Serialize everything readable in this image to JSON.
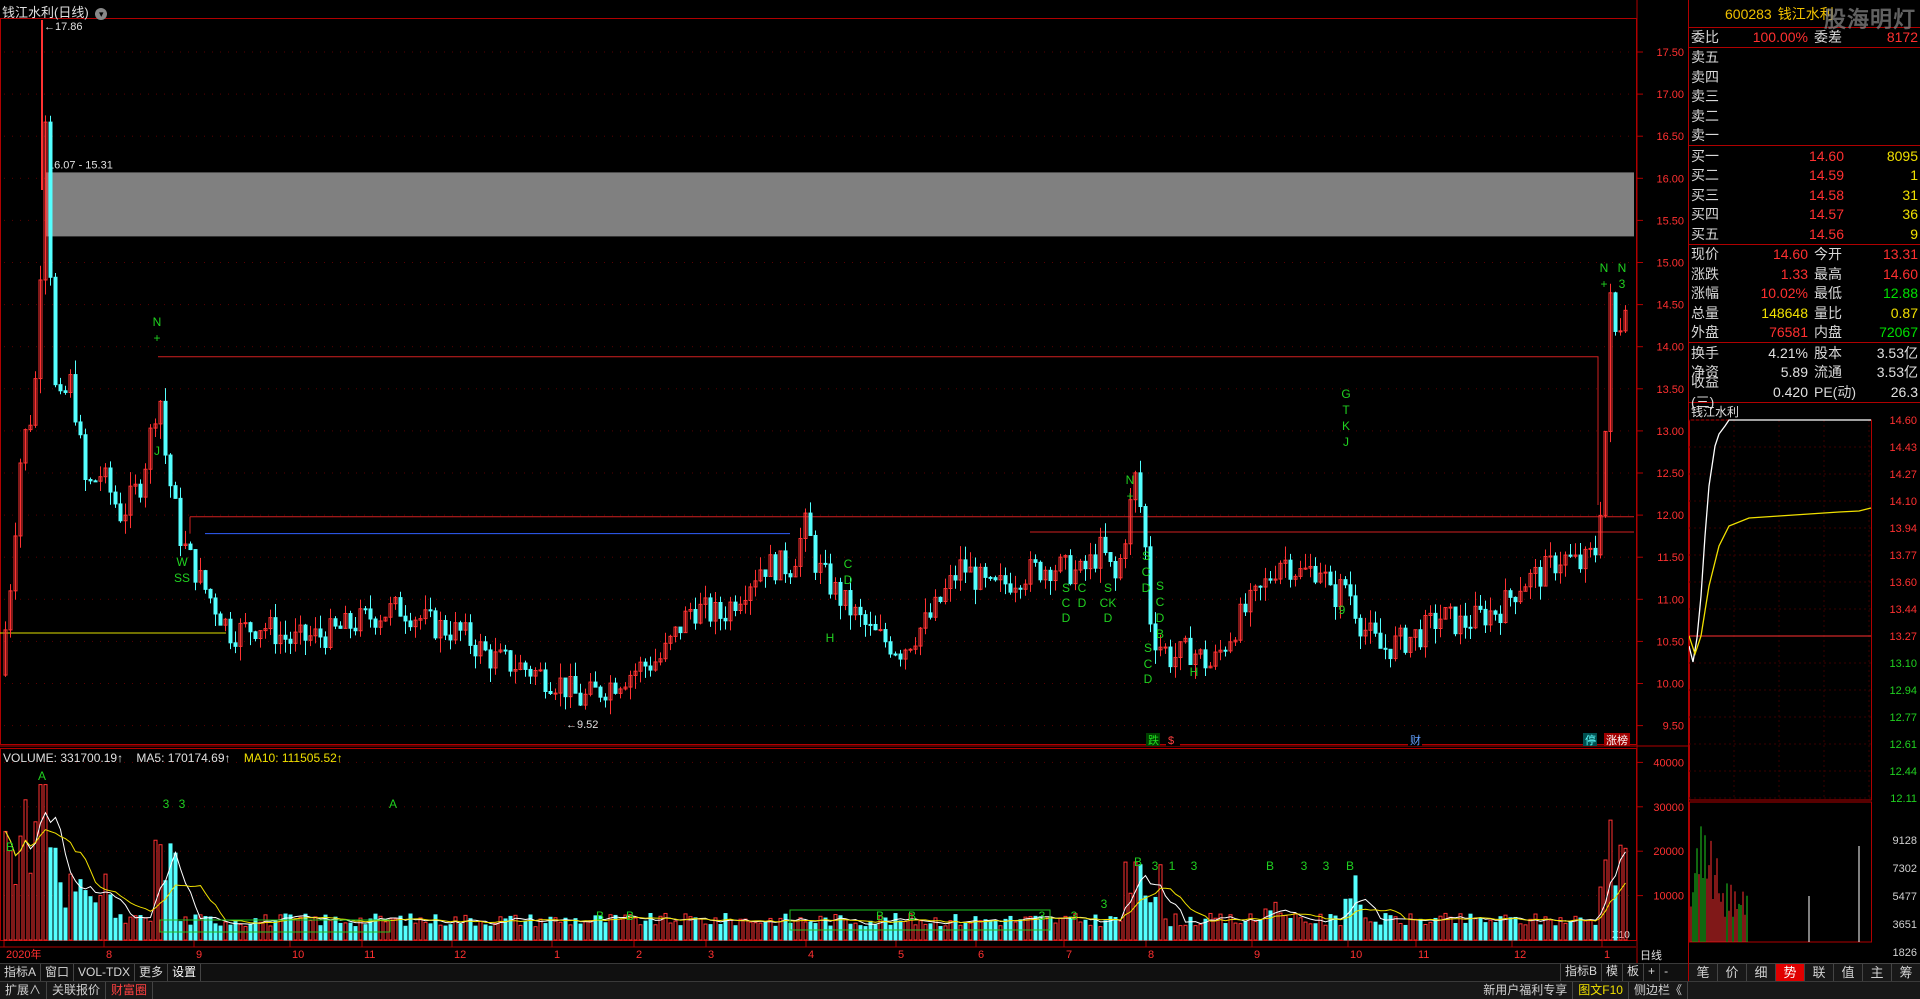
{
  "chart": {
    "title": "钱江水利(日线)",
    "high_label": "17.86",
    "range_label": "16.07 - 15.31",
    "low_label": "9.52",
    "price_axis": [
      "17.50",
      "17.00",
      "16.50",
      "16.00",
      "15.50",
      "15.00",
      "14.50",
      "14.00",
      "13.50",
      "13.00",
      "12.50",
      "12.00",
      "11.50",
      "11.00",
      "10.50",
      "10.00",
      "9.50"
    ],
    "vol_axis": [
      "40000",
      "30000",
      "20000",
      "10000"
    ],
    "vol_unit": "X10",
    "months": [
      "2020年",
      "8",
      "9",
      "10",
      "11",
      "12",
      "1",
      "2",
      "3",
      "4",
      "5",
      "6",
      "7",
      "8",
      "9",
      "10",
      "11",
      "12",
      "1"
    ],
    "period_label": "日线",
    "event_labels": [
      "跌",
      "$",
      "财",
      "停",
      "涨榜"
    ]
  },
  "volume": {
    "label": "VOLUME: 331700.19↑",
    "ma5": "MA5: 170174.69↑",
    "ma10": "MA10: 111505.52↑"
  },
  "tabs": {
    "row1": [
      "指标A",
      "窗口",
      "VOL-TDX",
      "更多",
      "设置"
    ],
    "row1_right": [
      "指标B",
      "模",
      "板",
      "+",
      "-"
    ],
    "row2": [
      "扩展∧",
      "关联报价",
      "财富圈"
    ],
    "row2_right": [
      "新用户福利专享",
      "图文F10",
      "侧边栏《"
    ]
  },
  "quote": {
    "code": "600283",
    "name": "钱江水利",
    "logo": "股海明灯",
    "weibi": {
      "label": "委比",
      "val": "100.00%",
      "lab2": "委差",
      "val2": "8172"
    },
    "sell": [
      {
        "label": "卖五",
        "price": "",
        "vol": ""
      },
      {
        "label": "卖四",
        "price": "",
        "vol": ""
      },
      {
        "label": "卖三",
        "price": "",
        "vol": ""
      },
      {
        "label": "卖二",
        "price": "",
        "vol": ""
      },
      {
        "label": "卖一",
        "price": "",
        "vol": ""
      }
    ],
    "buy": [
      {
        "label": "买一",
        "price": "14.60",
        "vol": "8095"
      },
      {
        "label": "买二",
        "price": "14.59",
        "vol": "1"
      },
      {
        "label": "买三",
        "price": "14.58",
        "vol": "31"
      },
      {
        "label": "买四",
        "price": "14.57",
        "vol": "36"
      },
      {
        "label": "买五",
        "price": "14.56",
        "vol": "9"
      }
    ],
    "stats1": [
      {
        "l1": "现价",
        "v1": "14.60",
        "l2": "今开",
        "v2": "13.31",
        "c1": "red",
        "c2": "red"
      },
      {
        "l1": "涨跌",
        "v1": "1.33",
        "l2": "最高",
        "v2": "14.60",
        "c1": "red",
        "c2": "red"
      },
      {
        "l1": "涨幅",
        "v1": "10.02%",
        "l2": "最低",
        "v2": "12.88",
        "c1": "red",
        "c2": "grn"
      },
      {
        "l1": "总量",
        "v1": "148648",
        "l2": "量比",
        "v2": "0.87",
        "c1": "yel",
        "c2": "yel"
      },
      {
        "l1": "外盘",
        "v1": "76581",
        "l2": "内盘",
        "v2": "72067",
        "c1": "red",
        "c2": "grn"
      }
    ],
    "stats2": [
      {
        "l1": "换手",
        "v1": "4.21%",
        "l2": "股本",
        "v2": "3.53亿"
      },
      {
        "l1": "净资",
        "v1": "5.89",
        "l2": "流通",
        "v2": "3.53亿"
      },
      {
        "l1": "收益(三)",
        "v1": "0.420",
        "l2": "PE(动)",
        "v2": "26.3"
      }
    ],
    "mini_title": "钱江水利",
    "mini_axis": [
      "14.60",
      "14.43",
      "14.27",
      "14.10",
      "13.94",
      "13.77",
      "13.60",
      "13.44",
      "13.27",
      "13.10",
      "12.94",
      "12.77",
      "12.61",
      "12.44",
      "12.11"
    ],
    "mini_vol_axis": [
      "9128",
      "7302",
      "5477",
      "3651",
      "1826"
    ],
    "bottom_tabs": [
      "笔",
      "价",
      "细",
      "势",
      "联",
      "值",
      "主",
      "筹"
    ]
  },
  "colors": {
    "up": "#ff3232",
    "down": "#54ffff",
    "ma5": "#ffffff",
    "ma10": "#f0e000",
    "ma20": "#ff40ff",
    "frame": "#b00000"
  }
}
